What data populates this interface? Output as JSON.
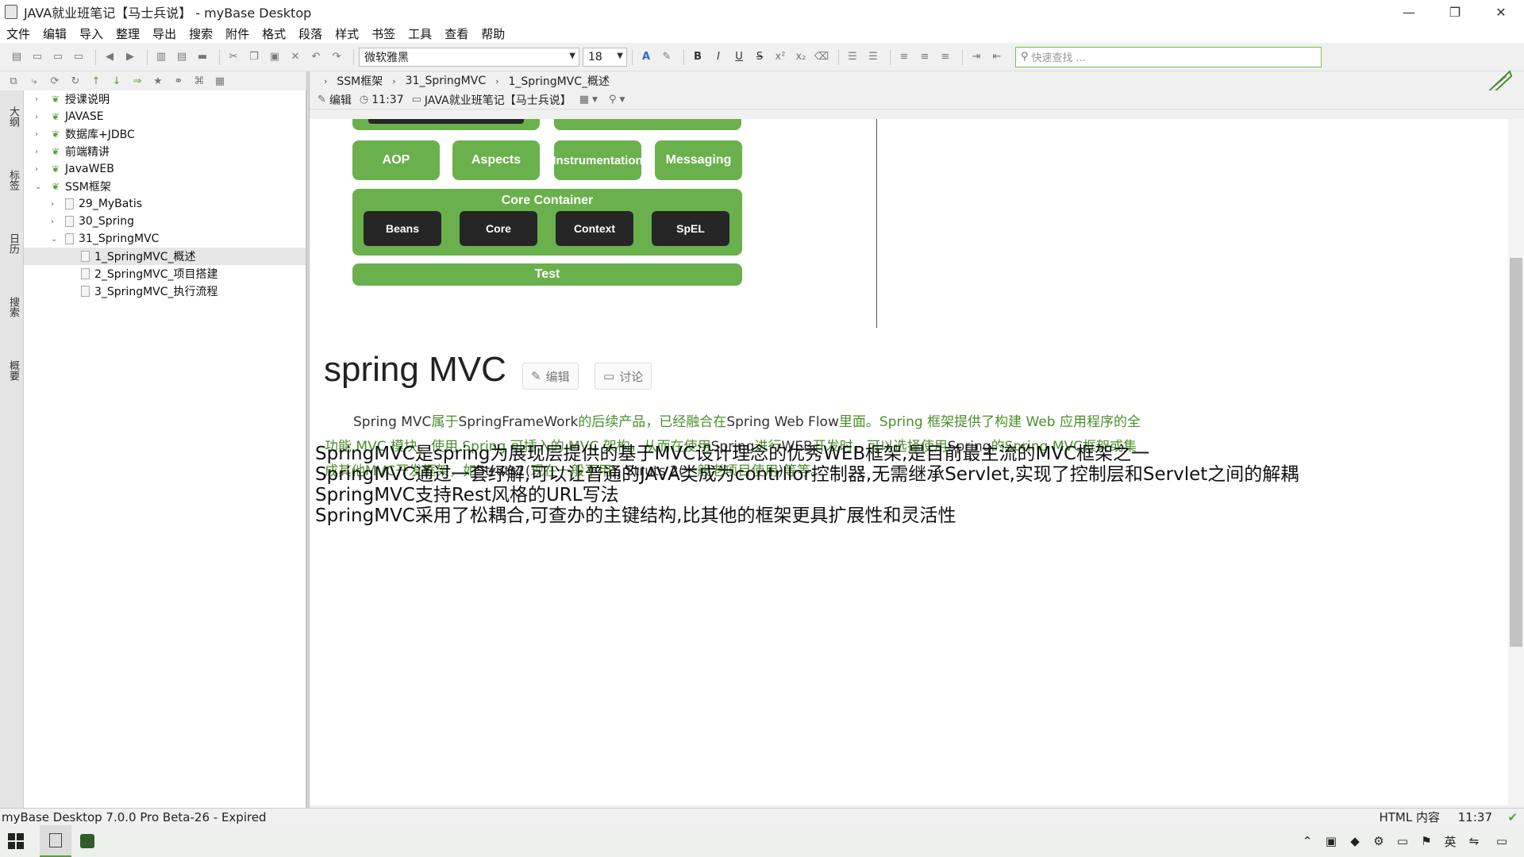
{
  "window": {
    "title": "JAVA就业班笔记【马士兵说】 - myBase Desktop"
  },
  "menu": [
    "文件",
    "编辑",
    "导入",
    "整理",
    "导出",
    "搜索",
    "附件",
    "格式",
    "段落",
    "样式",
    "书签",
    "工具",
    "查看",
    "帮助"
  ],
  "toolbar": {
    "font_family": "微软雅黑",
    "font_size": "18",
    "search_placeholder": "快速查找 ..."
  },
  "side_tabs": [
    "大纲",
    "标签",
    "日历",
    "搜索",
    "概要"
  ],
  "tree": [
    {
      "label": "授课说明",
      "level": 0,
      "type": "folder",
      "expanded": false
    },
    {
      "label": "JAVASE",
      "level": 0,
      "type": "folder",
      "expanded": false
    },
    {
      "label": "数据库+JDBC",
      "level": 0,
      "type": "folder",
      "expanded": false
    },
    {
      "label": "前端精讲",
      "level": 0,
      "type": "folder",
      "expanded": false
    },
    {
      "label": "JavaWEB",
      "level": 0,
      "type": "folder",
      "expanded": false
    },
    {
      "label": "SSM框架",
      "level": 0,
      "type": "folder",
      "expanded": true
    },
    {
      "label": "29_MyBatis",
      "level": 1,
      "type": "doc",
      "expanded": false
    },
    {
      "label": "30_Spring",
      "level": 1,
      "type": "doc",
      "expanded": false
    },
    {
      "label": "31_SpringMVC",
      "level": 1,
      "type": "doc",
      "expanded": true
    },
    {
      "label": "1_SpringMVC_概述",
      "level": 2,
      "type": "doc",
      "selected": true
    },
    {
      "label": "2_SpringMVC_项目搭建",
      "level": 2,
      "type": "doc"
    },
    {
      "label": "3_SpringMVC_执行流程",
      "level": 2,
      "type": "doc"
    }
  ],
  "breadcrumb": [
    "SSM框架",
    "31_SpringMVC",
    "1_SpringMVC_概述"
  ],
  "infobar": {
    "edit": "编辑",
    "time": "11:37",
    "notebook": "JAVA就业班笔记【马士兵说】"
  },
  "diagram": {
    "row1": [
      "AOP",
      "Aspects",
      "Instrumentation",
      "Messaging"
    ],
    "core_title": "Core Container",
    "core": [
      "Beans",
      "Core",
      "Context",
      "SpEL"
    ],
    "test": "Test"
  },
  "article": {
    "heading": "spring MVC",
    "edit_btn": "编辑",
    "discuss_btn": "讨论",
    "para_parts": [
      {
        "t": "Spring MVC",
        "g": false
      },
      {
        "t": "属于",
        "g": true
      },
      {
        "t": "SpringFrameWork",
        "g": false
      },
      {
        "t": "的后续产品，已经融合在",
        "g": true
      },
      {
        "t": "Spring Web Flow",
        "g": false
      },
      {
        "t": "里面。",
        "g": true
      },
      {
        "t": "Spring 框架提供了构建 Web 应用程序的全功能 MVC 模块。使用 Spring 可插入的 MVC 架构，从而在使用",
        "g": true
      },
      {
        "t": "Spring",
        "g": false
      },
      {
        "t": "进行",
        "g": true
      },
      {
        "t": "WEB",
        "g": false
      },
      {
        "t": "开发时，可以选择使用",
        "g": true
      },
      {
        "t": "Spring",
        "g": false
      },
      {
        "t": "的",
        "g": true
      },
      {
        "t": "Spring MVC",
        "g": false
      },
      {
        "t": "框架或集成其他",
        "g": true
      },
      {
        "t": "MVC",
        "g": false
      },
      {
        "t": "开发框架，如",
        "g": true
      },
      {
        "t": "Struts1(",
        "g": false
      },
      {
        "t": "现在一般不用",
        "g": true
      },
      {
        "t": "), Struts 2(",
        "g": false
      },
      {
        "t": "一般老项目使用",
        "g": true
      },
      {
        "t": ")",
        "g": false
      },
      {
        "t": "等等。",
        "g": true
      }
    ],
    "lines": [
      "SpringMVC是spring为展现层提供的基于MVC设计理念的优秀WEB框架,是目前最主流的MVC框架之一",
      "SpringMVC通过一套纾解,可以让普通的JAVA类成为contrllor控制器,无需继承Servlet,实现了控制层和Servlet之间的解耦",
      "SpringMVC支持Rest风格的URL写法",
      "SpringMVC采用了松耦合,可查办的主键结构,比其他的框架更具扩展性和灵活性"
    ]
  },
  "status": {
    "left": "myBase Desktop 7.0.0 Pro Beta-26 - Expired",
    "mode": "HTML 内容",
    "time": "11:37"
  }
}
